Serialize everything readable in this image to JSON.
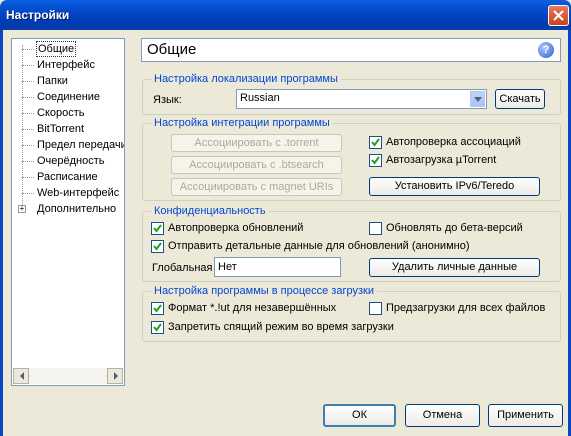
{
  "window": {
    "title": "Настройки"
  },
  "tree": {
    "items": [
      {
        "label": "Общие"
      },
      {
        "label": "Интерфейс"
      },
      {
        "label": "Папки"
      },
      {
        "label": "Соединение"
      },
      {
        "label": "Скорость"
      },
      {
        "label": "BitTorrent"
      },
      {
        "label": "Предел передачи"
      },
      {
        "label": "Очерёдность"
      },
      {
        "label": "Расписание"
      },
      {
        "label": "Web-интерфейс"
      },
      {
        "label": "Дополнительно"
      }
    ]
  },
  "page": {
    "title": "Общие",
    "help_icon": "?"
  },
  "localization": {
    "title": "Настройка локализации программы",
    "language_label": "Язык:",
    "language_value": "Russian",
    "download_button": "Скачать"
  },
  "integration": {
    "title": "Настройка интеграции программы",
    "assoc_torrent": "Ассоциировать с .torrent",
    "assoc_btsearch": "Ассоциировать с .btsearch",
    "assoc_magnet": "Ассоциировать с magnet URIs",
    "auto_check_assoc": "Автопроверка ассоциаций",
    "auto_check_assoc_checked": true,
    "autostart": "Автозагрузка µTorrent",
    "autostart_checked": true,
    "install_ipv6": "Установить IPv6/Teredo"
  },
  "privacy": {
    "title": "Конфиденциальность",
    "auto_updates": "Автопроверка обновлений",
    "auto_updates_checked": true,
    "beta_updates": "Обновлять до бета-версий",
    "beta_updates_checked": false,
    "send_details": "Отправить детальные данные для обновлений (анонимно)",
    "send_details_checked": true,
    "global_label": "Глобальная",
    "global_value": "Нет",
    "delete_personal": "Удалить личные данные"
  },
  "download": {
    "title": "Настройка программы в процессе загрузки",
    "format_ut": "Формат *.!ut для незавершённых",
    "format_ut_checked": true,
    "preallocate": "Предзагрузки для всех файлов",
    "preallocate_checked": false,
    "prevent_sleep": "Запретить спящий режим во время загрузки",
    "prevent_sleep_checked": true
  },
  "footer": {
    "ok": "ОК",
    "cancel": "Отмена",
    "apply": "Применить"
  }
}
